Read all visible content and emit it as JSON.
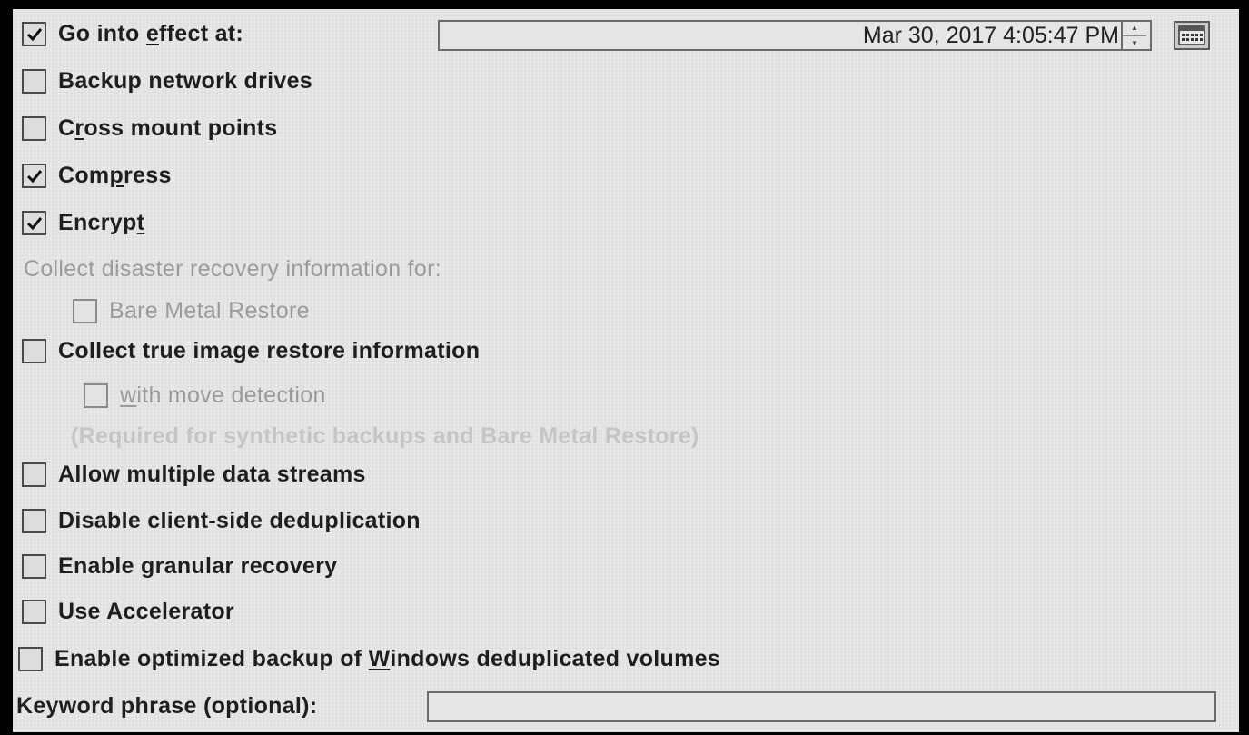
{
  "options": {
    "go_into_effect": {
      "label_pre": "Go into ",
      "label_mn": "e",
      "label_post": "ffect at:",
      "checked": true
    },
    "backup_network_drives": {
      "label": "Backup network drives",
      "checked": false
    },
    "cross_mount_points": {
      "label_pre": "C",
      "label_mn": "r",
      "label_post": "oss mount points",
      "checked": false
    },
    "compress": {
      "label_pre": "Com",
      "label_mn": "p",
      "label_post": "ress",
      "checked": true
    },
    "encrypt": {
      "label_pre": "Encryp",
      "label_mn": "t",
      "label_post": "",
      "checked": true
    },
    "disaster_recovery_heading": "Collect disaster recovery information for:",
    "bare_metal_restore": {
      "label": "Bare Metal Restore",
      "checked": false
    },
    "true_image_restore": {
      "label": "Collect true image restore information",
      "checked": false
    },
    "move_detection": {
      "label_mn": "w",
      "label_post": "ith move detection",
      "checked": false
    },
    "required_note": "(Required for synthetic backups and Bare Metal Restore)",
    "multiple_data_streams": {
      "label": "Allow multiple data streams",
      "checked": false
    },
    "disable_dedup": {
      "label": "Disable client-side deduplication",
      "checked": false
    },
    "granular_recovery": {
      "label": "Enable granular recovery",
      "checked": false
    },
    "use_accelerator": {
      "label": "Use Accelerator",
      "checked": false
    },
    "optimized_backup": {
      "label_pre": "Enable optimized backup of ",
      "label_mn": "W",
      "label_post": "indows deduplicated volumes",
      "checked": false
    }
  },
  "effective_datetime": "Mar 30, 2017 4:05:47 PM",
  "keyword": {
    "label": "Keyword phrase (optional):",
    "value": ""
  },
  "icons": {
    "check": "checkmark-icon",
    "spinner_up": "spinner-up-icon",
    "spinner_down": "spinner-down-icon",
    "calendar": "calendar-icon"
  }
}
